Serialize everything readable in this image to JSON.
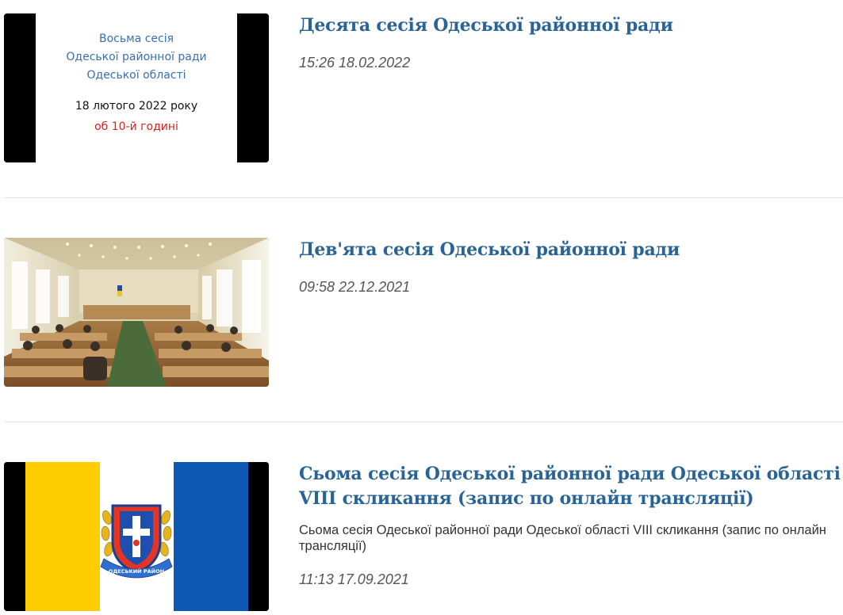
{
  "items": [
    {
      "title": "Десята сесія Одеської районної ради",
      "date": "15:26 18.02.2022",
      "thumbnail": {
        "line1": "Восьма  сесія",
        "line2": "Одеської районної ради",
        "line3": "Одеської області",
        "line4": "18 лютого 2022 року",
        "line5": "об 10-й годині",
        "text_color": "#3a6fb0",
        "accent_color": "#d9221c"
      }
    },
    {
      "title": "Дев'ята сесія Одеської районної ради",
      "date": "09:58 22.12.2021"
    },
    {
      "title": "Сьома сесія Одеської районної ради Одеської області VIII скликання (запис по онлайн трансляції)",
      "description": "Сьома сесія Одеської районної ради Одеської області VIII скликання (запис по онлайн трансляції)",
      "date": "11:13 17.09.2021",
      "thumbnail": {
        "flag_colors": [
          "#ffcc00",
          "#ffffff",
          "#0d57b5"
        ],
        "emblem_text": "ОДЕСЬКИЙ РАЙОН"
      }
    }
  ],
  "colors": {
    "title": "#2a6496",
    "date": "#555555",
    "divider": "#e3e3e3"
  }
}
